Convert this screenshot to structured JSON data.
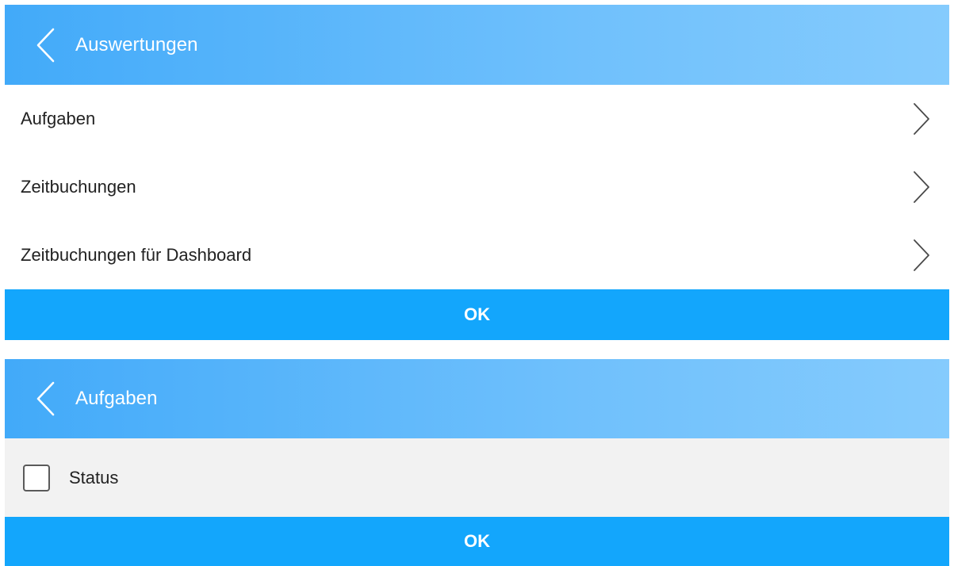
{
  "panels": [
    {
      "header": {
        "title": "Auswertungen",
        "back_icon": "chevron-left-icon"
      },
      "items": [
        {
          "label": "Aufgaben",
          "icon": "chevron-right-icon"
        },
        {
          "label": "Zeitbuchungen",
          "icon": "chevron-right-icon"
        },
        {
          "label": "Zeitbuchungen für Dashboard",
          "icon": "chevron-right-icon"
        }
      ],
      "ok_label": "OK"
    },
    {
      "header": {
        "title": "Aufgaben",
        "back_icon": "chevron-left-icon"
      },
      "checkboxes": [
        {
          "label": "Status",
          "checked": false
        }
      ],
      "ok_label": "OK"
    }
  ],
  "colors": {
    "header_gradient_start": "#42aaf9",
    "header_gradient_end": "#85cbfd",
    "ok_button": "#13a6fc",
    "checkbox_row_bg": "#f2f2f2",
    "text": "#222222"
  }
}
